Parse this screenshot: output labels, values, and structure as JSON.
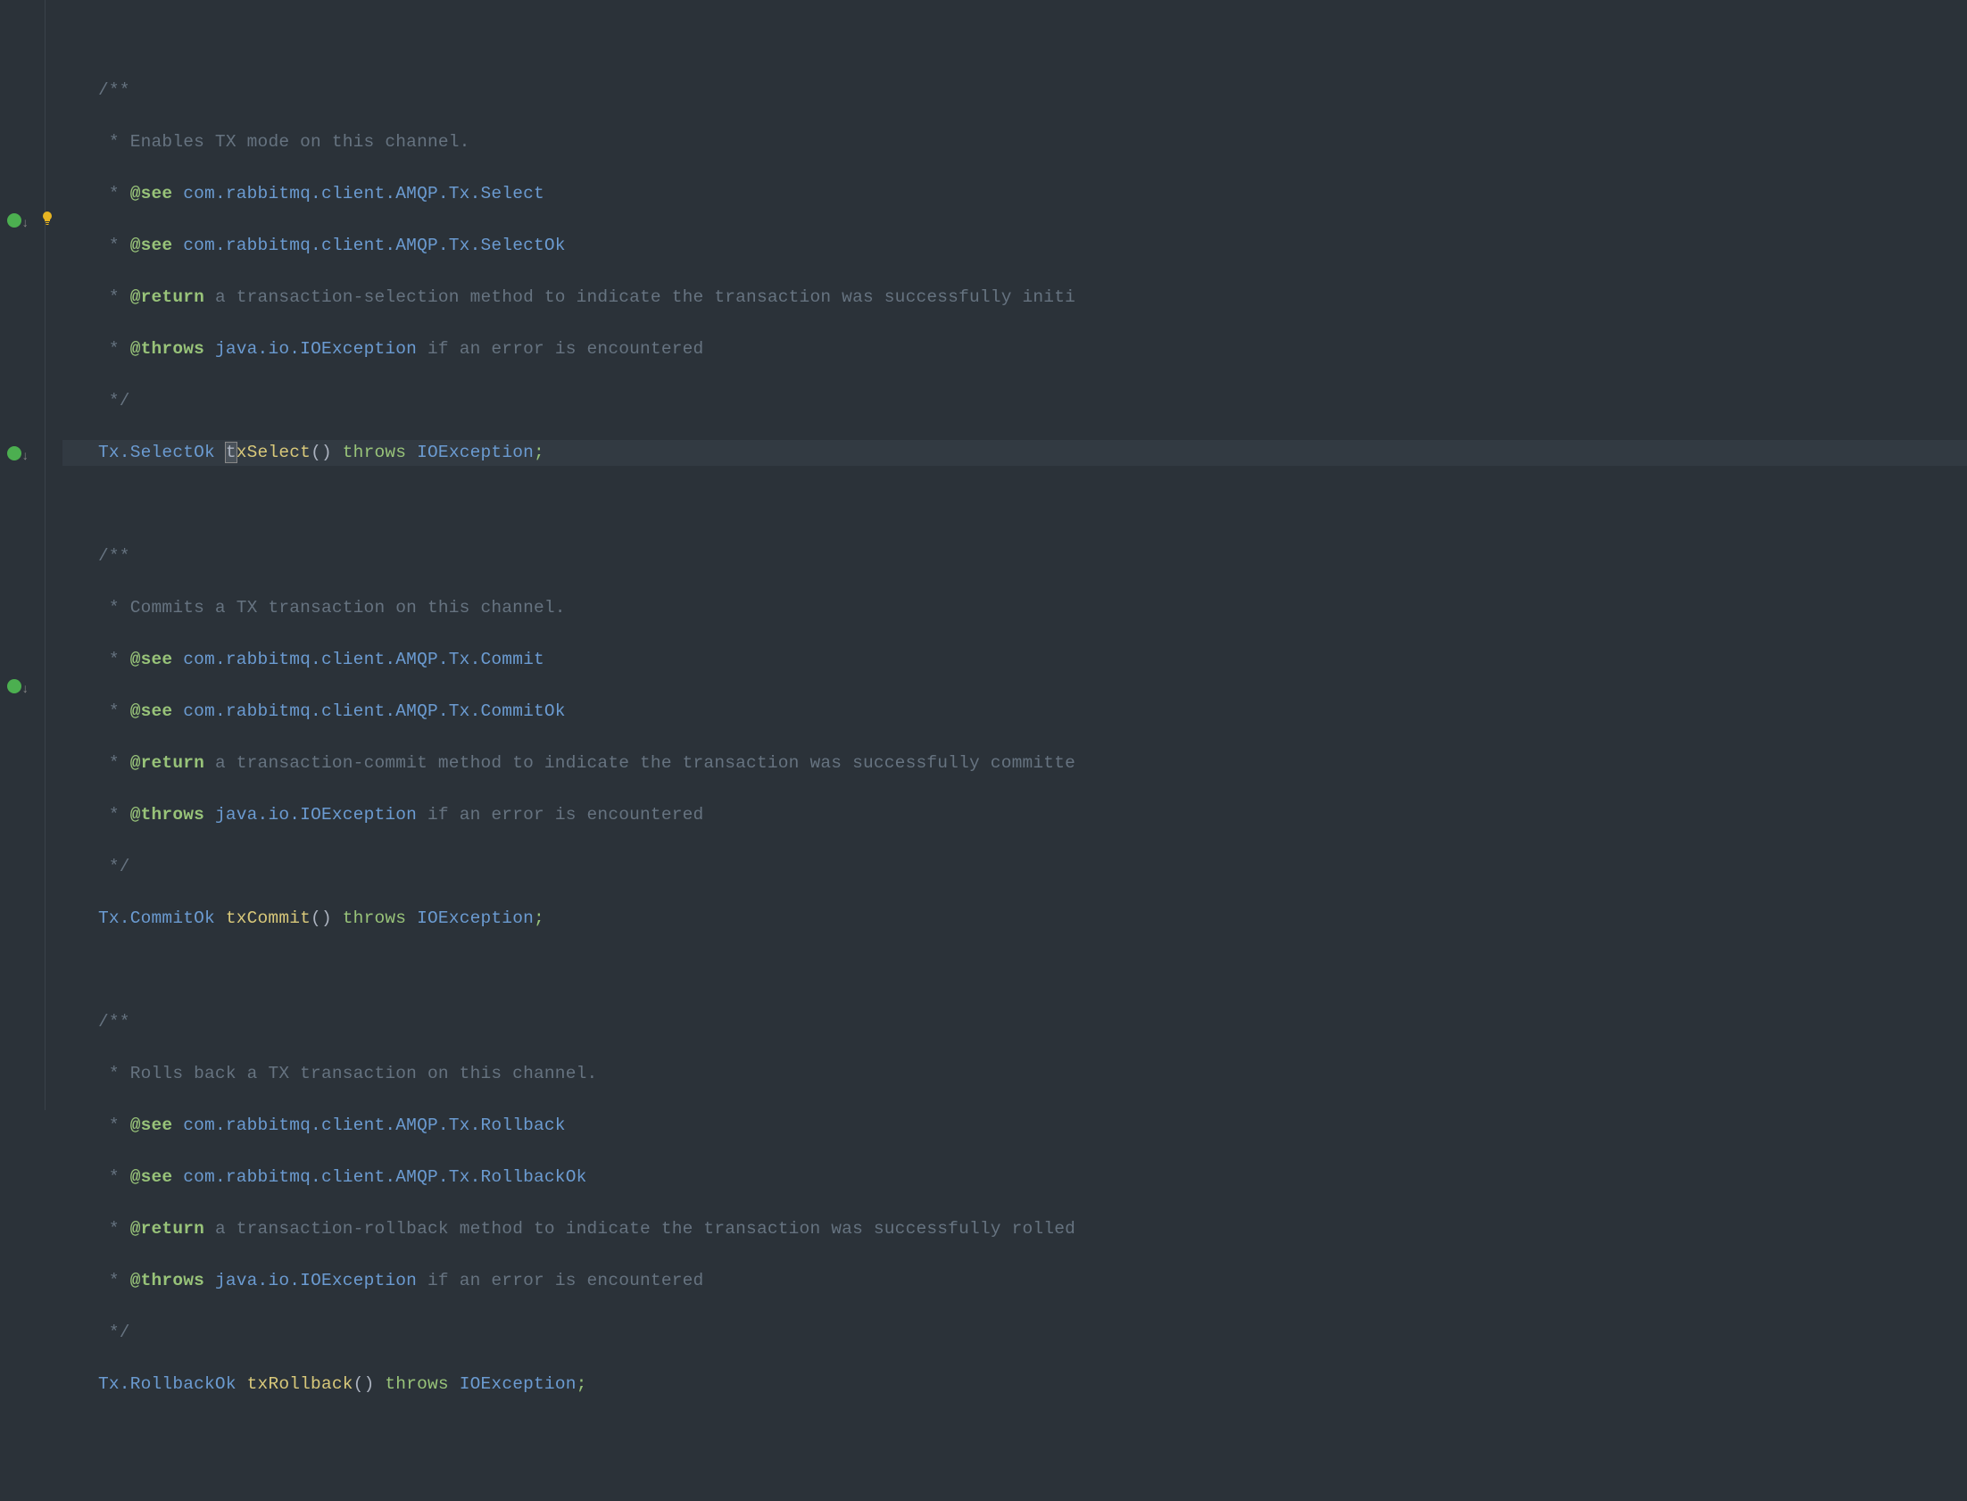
{
  "lines": {
    "l1": "/**",
    "l2_pre": " * ",
    "l2_txt": "Enables TX mode on this channel.",
    "l3_pre": " * ",
    "l3_tag": "@see",
    "l3_link": "com.rabbitmq.client.AMQP.Tx.Select",
    "l4_pre": " * ",
    "l4_tag": "@see",
    "l4_link": "com.rabbitmq.client.AMQP.Tx.SelectOk",
    "l5_pre": " * ",
    "l5_tag": "@return",
    "l5_txt": " a transaction-selection method to indicate the transaction was successfully initi",
    "l6_pre": " * ",
    "l6_tag": "@throws",
    "l6_link": "java.io.IOException",
    "l6_txt": " if an error is encountered",
    "l7": " */",
    "l8_type": "Tx.SelectOk",
    "l8_caret": "t",
    "l8_method": "xSelect",
    "l8_throws": "throws",
    "l8_ex": "IOException",
    "l9": "/**",
    "l10_pre": " * ",
    "l10_txt": "Commits a TX transaction on this channel.",
    "l11_pre": " * ",
    "l11_tag": "@see",
    "l11_link": "com.rabbitmq.client.AMQP.Tx.Commit",
    "l12_pre": " * ",
    "l12_tag": "@see",
    "l12_link": "com.rabbitmq.client.AMQP.Tx.CommitOk",
    "l13_pre": " * ",
    "l13_tag": "@return",
    "l13_txt": " a transaction-commit method to indicate the transaction was successfully committe",
    "l14_pre": " * ",
    "l14_tag": "@throws",
    "l14_link": "java.io.IOException",
    "l14_txt": " if an error is encountered",
    "l15": " */",
    "l16_type": "Tx.CommitOk",
    "l16_method": "txCommit",
    "l16_throws": "throws",
    "l16_ex": "IOException",
    "l17": "/**",
    "l18_pre": " * ",
    "l18_txt": "Rolls back a TX transaction on this channel.",
    "l19_pre": " * ",
    "l19_tag": "@see",
    "l19_link": "com.rabbitmq.client.AMQP.Tx.Rollback",
    "l20_pre": " * ",
    "l20_tag": "@see",
    "l20_link": "com.rabbitmq.client.AMQP.Tx.RollbackOk",
    "l21_pre": " * ",
    "l21_tag": "@return",
    "l21_txt": " a transaction-rollback method to indicate the transaction was successfully rolled",
    "l22_pre": " * ",
    "l22_tag": "@throws",
    "l22_link": "java.io.IOException",
    "l22_txt": " if an error is encountered",
    "l23": " */",
    "l24_type": "Tx.RollbackOk",
    "l24_method": "txRollback",
    "l24_throws": "throws",
    "l24_ex": "IOException"
  },
  "gutter": {
    "impl_marker": "implementation-marker",
    "bulb": "bulb-icon"
  }
}
